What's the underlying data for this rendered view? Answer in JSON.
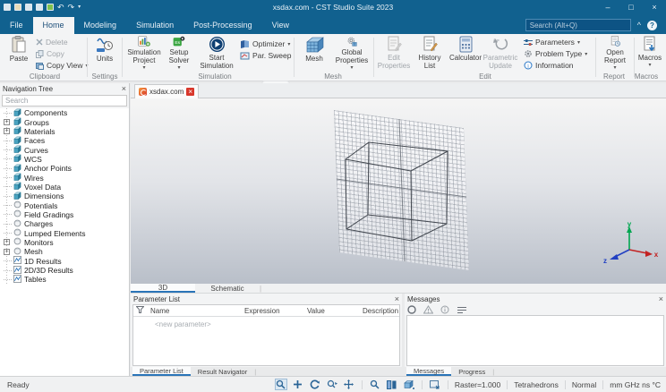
{
  "glyphs": {
    "minimize": "–",
    "maximize": "□",
    "close": "×",
    "caret_down": "▾",
    "caret_up": "^",
    "help": "?",
    "plus": "+",
    "pipe": "|",
    "undo": "↶",
    "redo": "↷",
    "play": "▶",
    "rotate_c": "C",
    "pan_plus": "+",
    "info_i": "i",
    "solver_es": "Es"
  },
  "titlebar": {
    "title": "xsdax.com - CST Studio Suite 2023",
    "search_placeholder": "Search (Alt+Q)"
  },
  "menu": {
    "items": [
      {
        "label": "File"
      },
      {
        "label": "Home"
      },
      {
        "label": "Modeling"
      },
      {
        "label": "Simulation"
      },
      {
        "label": "Post-Processing"
      },
      {
        "label": "View"
      }
    ]
  },
  "ribbon": {
    "clipboard": {
      "paste": "Paste",
      "delete": "Delete",
      "copy": "Copy",
      "copy_view": "Copy View",
      "label": "Clipboard"
    },
    "settings": {
      "units": "Units",
      "label": "Settings"
    },
    "simulation": {
      "project": "Simulation\nProject",
      "setup_solver": "Setup\nSolver",
      "start": "Start\nSimulation",
      "optimizer": "Optimizer",
      "par_sweep": "Par. Sweep",
      "label": "Simulation"
    },
    "mesh": {
      "mesh_view": "Mesh",
      "global_properties": "Global\nProperties",
      "label": "Mesh"
    },
    "edit": {
      "edit_properties": "Edit\nProperties",
      "history_list": "History\nList",
      "calculator": "Calculator",
      "parametric_update": "Parametric\nUpdate",
      "parameters": "Parameters",
      "problem_type": "Problem Type",
      "information": "Information",
      "label": "Edit"
    },
    "report": {
      "open_report": "Open\nReport",
      "label": "Report"
    },
    "macros": {
      "macros": "Macros",
      "label": "Macros"
    }
  },
  "nav_tree": {
    "title": "Navigation Tree",
    "search_placeholder": "Search",
    "items": [
      {
        "label": "Components"
      },
      {
        "label": "Groups"
      },
      {
        "label": "Materials"
      },
      {
        "label": "Faces"
      },
      {
        "label": "Curves"
      },
      {
        "label": "WCS"
      },
      {
        "label": "Anchor Points"
      },
      {
        "label": "Wires"
      },
      {
        "label": "Voxel Data"
      },
      {
        "label": "Dimensions"
      },
      {
        "label": "Potentials"
      },
      {
        "label": "Field Gradings"
      },
      {
        "label": "Charges"
      },
      {
        "label": "Lumped Elements"
      },
      {
        "label": "Monitors"
      },
      {
        "label": "Mesh"
      },
      {
        "label": "1D Results"
      },
      {
        "label": "2D/3D Results"
      },
      {
        "label": "Tables"
      }
    ]
  },
  "doc_tab": {
    "label": "xsdax.com"
  },
  "view_tabs": {
    "d3": "3D",
    "schematic": "Schematic"
  },
  "axes": {
    "x": "x",
    "y": "y",
    "z": "z"
  },
  "param_panel": {
    "title": "Parameter List",
    "columns": [
      "Name",
      "Expression",
      "Value",
      "Description"
    ],
    "new_row": "<new parameter>",
    "tab_param": "Parameter List",
    "tab_result": "Result Navigator"
  },
  "messages_panel": {
    "title": "Messages",
    "tab_messages": "Messages",
    "tab_progress": "Progress"
  },
  "status_bar": {
    "ready": "Ready",
    "raster": "Raster=1.000",
    "mesh_type": "Tetrahedrons",
    "mode": "Normal",
    "units": "mm GHz ns °C"
  }
}
